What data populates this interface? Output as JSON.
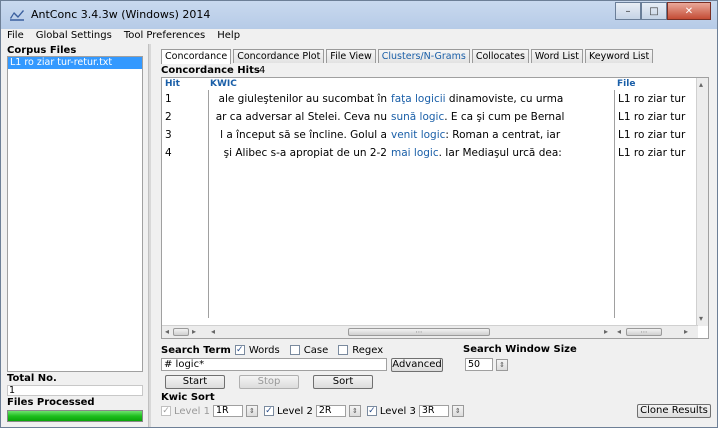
{
  "window": {
    "title": "AntConc 3.4.3w (Windows) 2014",
    "min": "–",
    "max": "□",
    "close": "✕"
  },
  "menu": [
    "File",
    "Global Settings",
    "Tool Preferences",
    "Help"
  ],
  "left_panel": {
    "corpus_files_label": "Corpus Files",
    "files": [
      "L1 ro ziar tur-retur.txt"
    ],
    "total_label": "Total No.",
    "total_value": "1",
    "processed_label": "Files Processed",
    "progress": 1.0
  },
  "tabs": [
    {
      "label": "Concordance",
      "active": true,
      "blue": false
    },
    {
      "label": "Concordance Plot",
      "active": false,
      "blue": false
    },
    {
      "label": "File View",
      "active": false,
      "blue": false
    },
    {
      "label": "Clusters/N-Grams",
      "active": false,
      "blue": true
    },
    {
      "label": "Collocates",
      "active": false,
      "blue": false
    },
    {
      "label": "Word List",
      "active": false,
      "blue": false
    },
    {
      "label": "Keyword List",
      "active": false,
      "blue": false
    }
  ],
  "concordance": {
    "hits_label": "Concordance Hits",
    "hits_count": "4",
    "col_hit": "Hit",
    "col_kwic": "KWIC",
    "col_file": "File",
    "rows": [
      {
        "hit": "1",
        "left": "ale giuleştenilor au sucombat în",
        "key": "faţa logicii",
        "right": " dinamoviste, cu urma",
        "file": "L1 ro ziar tur"
      },
      {
        "hit": "2",
        "left": "ar ca adversar al Stelei. Ceva nu",
        "key": "sună logic",
        "right": ". E ca şi cum pe Bernal",
        "file": "L1 ro ziar tur"
      },
      {
        "hit": "3",
        "left": "l a început să se încline. Golul a",
        "key": "venit logic",
        "right": ": Roman a centrat, iar",
        "file": "L1 ro ziar tur"
      },
      {
        "hit": "4",
        "left": "şi Alibec s-a apropiat de un 2-2",
        "key": "mai logic",
        "right": ". Iar Mediaşul urcă dea:",
        "file": "L1 ro ziar tur"
      }
    ]
  },
  "search": {
    "term_label": "Search Term",
    "words_label": "Words",
    "words_checked": true,
    "case_label": "Case",
    "case_checked": false,
    "regex_label": "Regex",
    "regex_checked": false,
    "value": "# logic*",
    "advanced_label": "Advanced",
    "window_size_label": "Search Window Size",
    "window_size_value": "50",
    "start_label": "Start",
    "stop_label": "Stop",
    "sort_label": "Sort"
  },
  "kwic_sort": {
    "label": "Kwic Sort",
    "level1_label": "Level 1",
    "level1_value": "1R",
    "level2_label": "Level 2",
    "level2_value": "2R",
    "level3_label": "Level 3",
    "level3_value": "3R",
    "clone_label": "Clone Results"
  }
}
